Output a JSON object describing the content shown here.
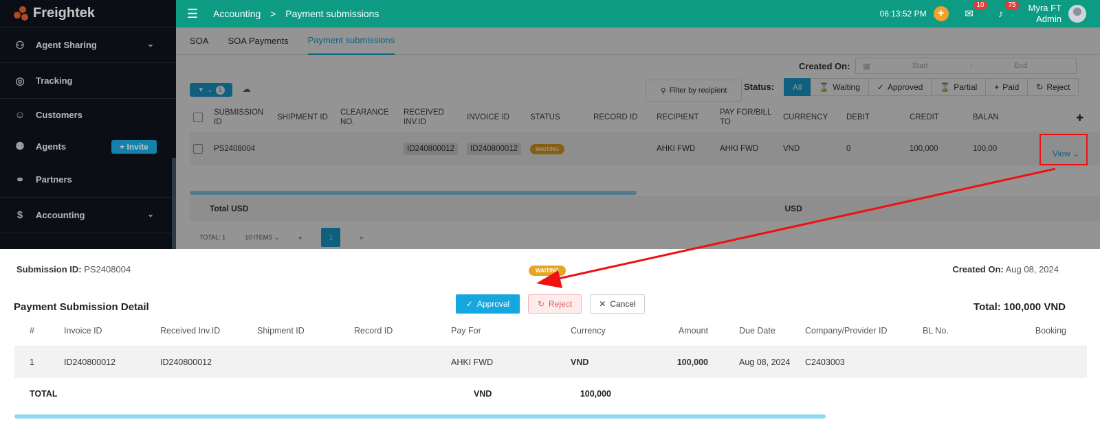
{
  "app": {
    "brand": "Freightek"
  },
  "sidebar": {
    "items": [
      {
        "label": "Agent Sharing",
        "icon": "share-network-icon",
        "has_chevron": true
      },
      {
        "label": "Tracking",
        "icon": "location-pin-icon"
      },
      {
        "label": "Customers",
        "icon": "customers-icon"
      },
      {
        "label": "Agents",
        "icon": "agents-icon",
        "action": "+ Invite"
      },
      {
        "label": "Partners",
        "icon": "handshake-icon"
      },
      {
        "label": "Accounting",
        "icon": "money-icon",
        "has_chevron": true
      }
    ]
  },
  "topbar": {
    "breadcrumb": [
      "Accounting",
      "Payment submissions"
    ],
    "separator": ">",
    "time": "06:13:52 PM",
    "messages_badge": "10",
    "notifications_badge": "75",
    "user_name": "Myra FT",
    "user_role": "Admin"
  },
  "tabs": [
    {
      "label": "SOA",
      "active": false
    },
    {
      "label": "SOA Payments",
      "active": false
    },
    {
      "label": "Payment submissions",
      "active": true
    }
  ],
  "filters": {
    "created_on_label": "Created On:",
    "start_placeholder": "Start",
    "range_separator": "-",
    "end_placeholder": "End",
    "filter_count": "1",
    "filter_recipient": "Filter by recipient",
    "status_label": "Status:",
    "status_options": [
      "All",
      "Waiting",
      "Approved",
      "Partial",
      "Paid",
      "Reject"
    ],
    "status_selected": "All"
  },
  "grid": {
    "columns": [
      "SUBMISSION ID",
      "SHIPMENT ID",
      "CLEARANCE NO.",
      "RECEIVED INV.ID",
      "INVOICE ID",
      "STATUS",
      "RECORD ID",
      "RECIPIENT",
      "PAY FOR/BILL TO",
      "CURRENCY",
      "DEBIT",
      "CREDIT",
      "BALAN"
    ],
    "rows": [
      {
        "submission_id": "PS2408004",
        "shipment_id": "",
        "clearance_no": "",
        "received_inv_id": "ID240800012",
        "invoice_id": "ID240800012",
        "status": "WAITING",
        "record_id": "",
        "recipient": "AHKI FWD",
        "pay_for": "AHKI FWD",
        "currency": "VND",
        "debit": "0",
        "credit": "100,000",
        "balance": "100,00",
        "action": "View"
      }
    ],
    "total_label": "Total USD",
    "total_currency": "USD"
  },
  "pager": {
    "total": "TOTAL: 1",
    "page_size": "10 ITEMS",
    "prev": "«",
    "current": "1",
    "next": "»"
  },
  "detail": {
    "submission_label": "Submission ID:",
    "submission_id": "PS2408004",
    "status": "WAITING",
    "created_on_label": "Created On:",
    "created_on": "Aug 08, 2024",
    "title": "Payment Submission Detail",
    "approve_label": "Approval",
    "reject_label": "Reject",
    "cancel_label": "Cancel",
    "total": "Total: 100,000 VND",
    "columns": [
      "#",
      "Invoice ID",
      "Received Inv.ID",
      "Shipment ID",
      "Record ID",
      "Pay For",
      "Currency",
      "Amount",
      "Due Date",
      "Company/Provider ID",
      "BL No.",
      "Booking"
    ],
    "rows": [
      {
        "num": "1",
        "invoice_id": "ID240800012",
        "received_inv_id": "ID240800012",
        "shipment_id": "",
        "record_id": "",
        "pay_for": "AHKI FWD",
        "currency": "VND",
        "amount": "100,000",
        "due_date": "Aug 08, 2024",
        "company_id": "C2403003",
        "bl_no": "",
        "booking": ""
      }
    ],
    "total_row": {
      "label": "TOTAL",
      "currency": "VND",
      "amount": "100,000"
    }
  },
  "colors": {
    "topbar": "#0d9b84",
    "accent": "#1aa6d9",
    "sidebar": "#0f141c",
    "waiting": "#e9a41f",
    "annotation": "#e11111"
  }
}
